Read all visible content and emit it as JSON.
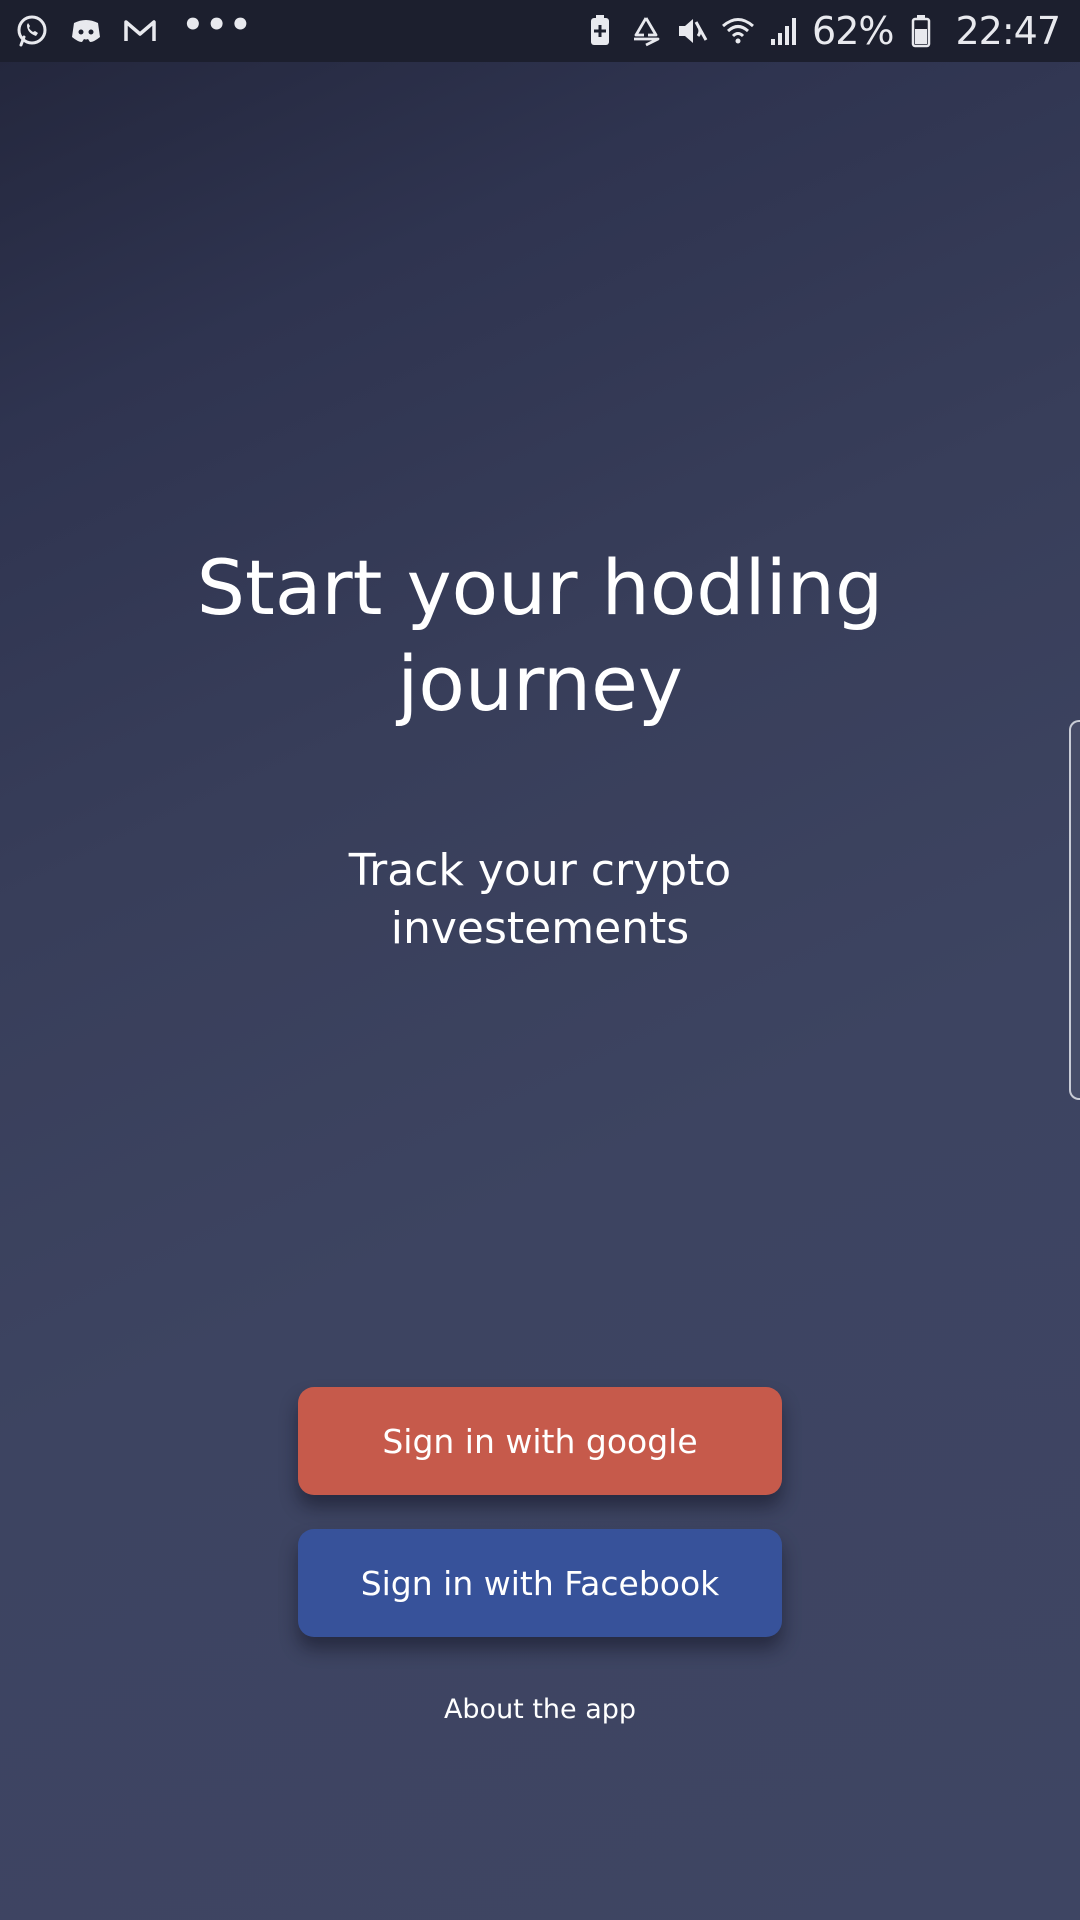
{
  "status_bar": {
    "left_icons": [
      "whatsapp-icon",
      "discord-icon",
      "gmail-icon"
    ],
    "more_indicator": "•••",
    "right_icons": [
      "battery-saver-icon",
      "recycle-icon",
      "mute-icon",
      "wifi-icon",
      "signal-icon"
    ],
    "battery_percent": "62%",
    "time": "22:47"
  },
  "hero": {
    "title_line1": "Start your hodling",
    "title_line2": "journey",
    "subtitle_line1": "Track your crypto",
    "subtitle_line2": "investements"
  },
  "actions": {
    "google_label": "Sign in with google",
    "facebook_label": "Sign in with Facebook",
    "about_label": "About the app"
  },
  "colors": {
    "background": "#3d4462",
    "status_bar": "#1c1f2e",
    "google_button": "#c65a4b",
    "facebook_button": "#37529a",
    "text": "#ffffff"
  }
}
